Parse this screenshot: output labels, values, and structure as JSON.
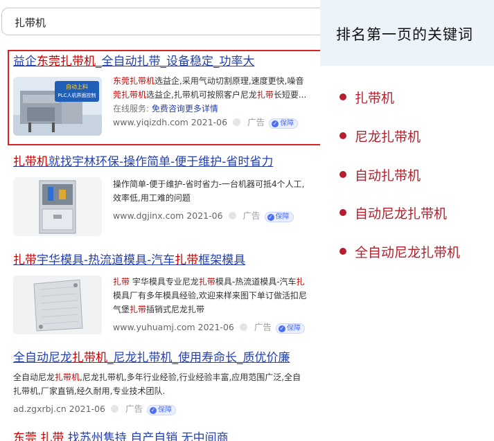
{
  "search": {
    "query": "扎带机"
  },
  "results": [
    {
      "title_parts": [
        "益企",
        "东莞扎带机",
        "_全自动扎带_设备稳定_功率大"
      ],
      "thumb_caption": [
        "自动上料",
        "PLC人机界面控制"
      ],
      "desc_line1": [
        "东莞扎带机",
        "选益企,采用气动切割原理,速度更快,噪音"
      ],
      "desc_line2": [
        "莞扎带机",
        "选益企,扎带机可按照客户尼龙",
        "扎带",
        "长短要..."
      ],
      "service_label": "在线服务:",
      "service_link": "免费咨询更多详情",
      "url": "www.yiqizdh.com",
      "date": "2021-06",
      "ad": "广告",
      "badge": "保障"
    },
    {
      "title_parts": [
        "扎带机",
        "就找宇林环保-操作简单-便于维护-省时省力"
      ],
      "desc_line1": "操作简单-便于维护-省时省力-一台机器可抵4个人工,",
      "desc_line2": "效率低,用工难的问题",
      "url": "www.dgjinx.com",
      "date": "2021-06",
      "ad": "广告",
      "badge": "保障"
    },
    {
      "title_parts": [
        "扎带",
        "宇华模具-热流道模具-汽车",
        "扎带",
        "框架模具"
      ],
      "desc_line1": [
        "扎带",
        " 宇华模具专业尼龙",
        "扎带",
        "模具-热流道模具-汽车",
        "扎"
      ],
      "desc_line2": "模具厂有多年模具经验,欢迎来样来图下单订做活扣尼",
      "desc_line3": [
        "气堡",
        "扎带",
        "插销式尼龙扎带"
      ],
      "url": "www.yuhuamj.com",
      "date": "2021-06",
      "ad": "广告",
      "badge": "保障"
    },
    {
      "title_parts": [
        "全自动尼龙",
        "扎带机",
        "_尼龙扎带机_使用寿命长_质优价廉"
      ],
      "desc_line1": [
        "全自动尼龙",
        "扎带机",
        ",尼龙扎带机,多年行业经验,行业经验丰富,应用范围广泛,全自"
      ],
      "desc_line2": "扎带机,厂家直销,经久耐用,专业技术团队.",
      "url": "ad.zgxrbj.cn",
      "date": "2021-06",
      "ad": "广告",
      "badge": "保障"
    },
    {
      "title_parts": [
        "东莞 扎带",
        " 找苏州隽持 自产自销 无中间商"
      ]
    }
  ],
  "sidebar": {
    "heading": "排名第一页的关键词",
    "keywords": [
      "扎带机",
      "尼龙扎带机",
      "自动扎带机",
      "自动尼龙扎带机",
      "全自动尼龙扎带机"
    ]
  }
}
